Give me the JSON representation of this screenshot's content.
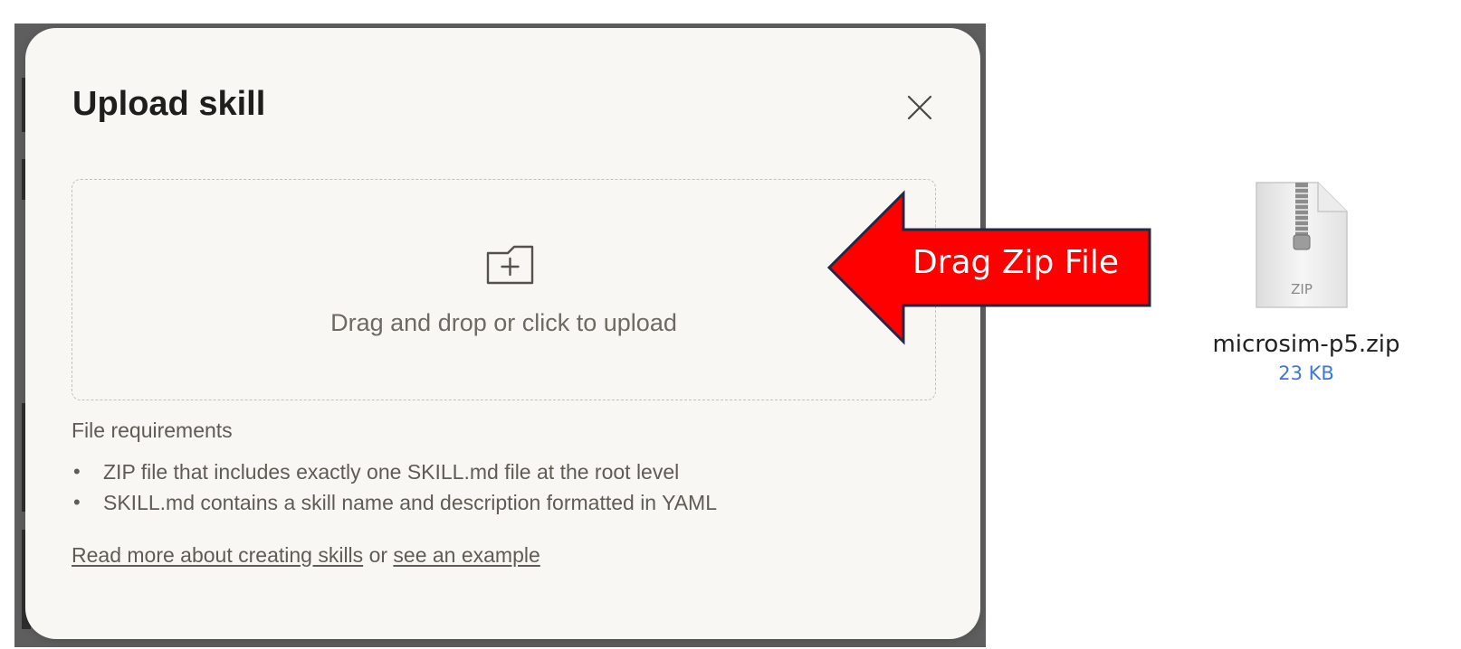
{
  "dialog": {
    "title": "Upload skill",
    "close_icon": "close-icon",
    "dropzone": {
      "icon": "folder-plus-icon",
      "text": "Drag and drop or click to upload"
    },
    "requirements": {
      "title": "File requirements",
      "items": [
        "ZIP file that includes exactly one SKILL.md file at the root level",
        "SKILL.md contains a skill name and description formatted in YAML"
      ]
    },
    "links": {
      "read_more": "Read more about creating skills",
      "separator": "or",
      "example": "see an example"
    }
  },
  "annotation": {
    "label": "Drag Zip File",
    "fill_color": "#ff0000",
    "stroke_color": "#1f2a44"
  },
  "file": {
    "icon": "zip-file-icon",
    "icon_label": "ZIP",
    "name": "microsim-p5.zip",
    "size": "23 KB",
    "size_color": "#3b78d8"
  }
}
